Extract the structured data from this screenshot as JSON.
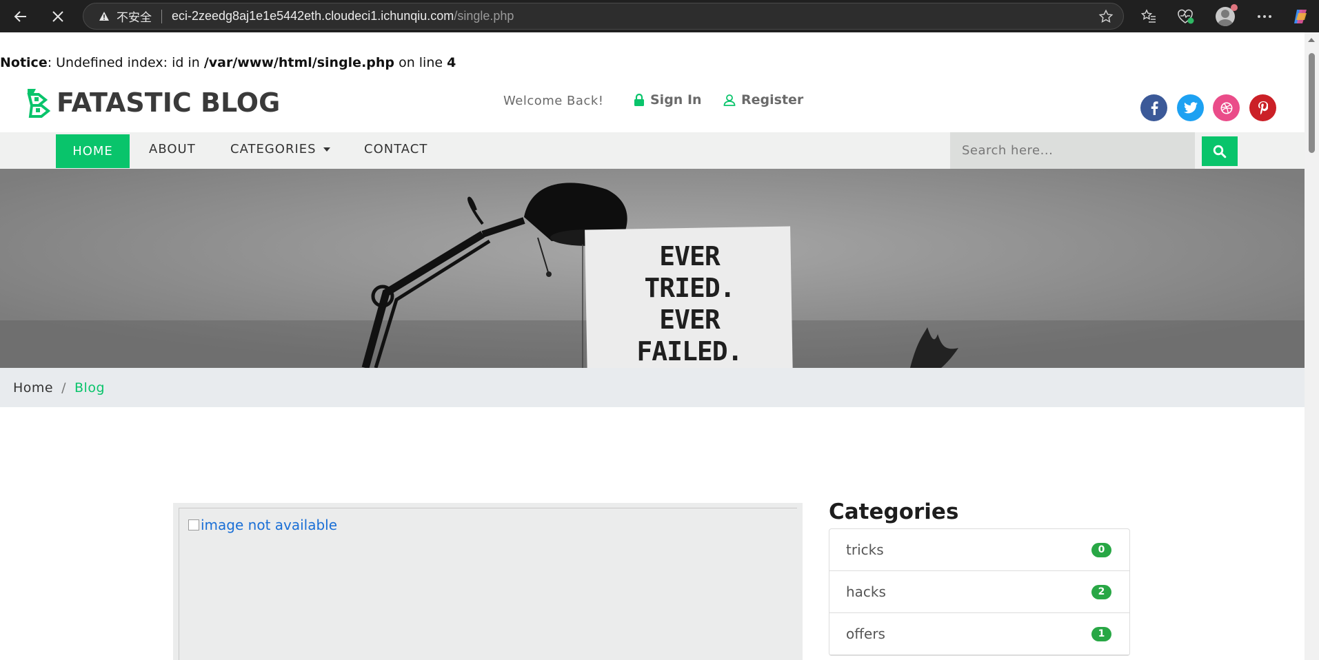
{
  "browser": {
    "security_label": "不安全",
    "url_host": "eci-2zeedg8aj1e1e5442eth.cloudeci1.ichunqiu.com",
    "url_path": "/single.php"
  },
  "notice": {
    "label": "Notice",
    "message_prefix": ": Undefined index: id in ",
    "file": "/var/www/html/single.php",
    "message_mid": " on line ",
    "line": "4"
  },
  "header": {
    "logo_text": "FATASTIC BLOG",
    "welcome": "Welcome Back!",
    "sign_in": "Sign In",
    "register": "Register",
    "social": [
      {
        "icon": "facebook-icon",
        "glyph": "f",
        "color": "#3b5998"
      },
      {
        "icon": "twitter-icon",
        "glyph": "t",
        "color": "#1da1f2"
      },
      {
        "icon": "dribbble-icon",
        "glyph": "d",
        "color": "#ea4c89"
      },
      {
        "icon": "pinterest-icon",
        "glyph": "p",
        "color": "#cb2027"
      }
    ]
  },
  "nav": {
    "home": "HOME",
    "about": "ABOUT",
    "categories": "CATEGORIES",
    "contact": "CONTACT",
    "search_placeholder": "Search here..."
  },
  "hero": {
    "poster_text": "EVER TRIED. EVER FAILED. NO MATTER. TRY AGAIN."
  },
  "breadcrumb": {
    "home": "Home",
    "separator": "/",
    "current": "Blog"
  },
  "post": {
    "image_alt": "image not available"
  },
  "sidebar": {
    "categories_title": "Categories",
    "categories": [
      {
        "name": "tricks",
        "count": "0"
      },
      {
        "name": "hacks",
        "count": "2"
      },
      {
        "name": "offers",
        "count": "1"
      }
    ]
  },
  "colors": {
    "accent": "#09c46b",
    "badge": "#28a745"
  }
}
